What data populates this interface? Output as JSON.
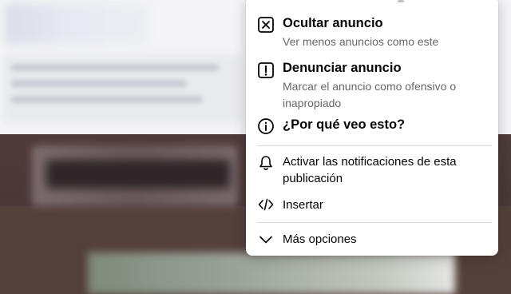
{
  "menu": {
    "hide_ad": {
      "title": "Ocultar anuncio",
      "subtitle": "Ver menos anuncios como este",
      "icon": "close-box-icon"
    },
    "report_ad": {
      "title": "Denunciar anuncio",
      "subtitle_line1": "Marcar el anuncio como ofensivo o",
      "subtitle_line2": "inapropiado",
      "icon": "exclamation-box-icon"
    },
    "why_ad": {
      "title": "¿Por qué veo esto?",
      "icon": "info-circle-icon"
    },
    "notifications": {
      "label_line1": "Activar las notificaciones de esta",
      "label_line2": "publicación",
      "icon": "bell-icon"
    },
    "embed": {
      "label": "Insertar",
      "icon": "code-icon"
    },
    "more": {
      "label": "Más opciones",
      "icon": "chevron-down-icon"
    }
  },
  "colors": {
    "text_primary": "#050505",
    "text_secondary": "#65676b",
    "divider": "#dadde1"
  }
}
